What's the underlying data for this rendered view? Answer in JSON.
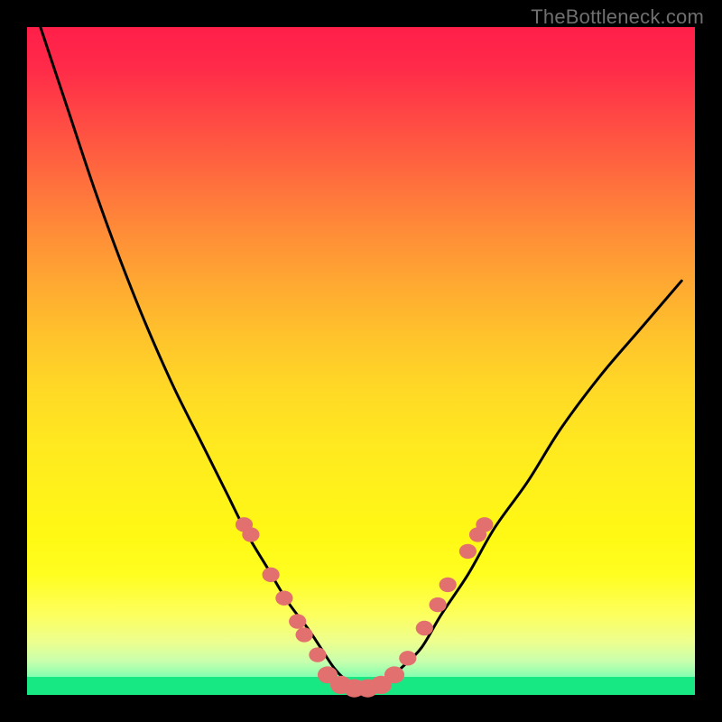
{
  "watermark": "TheBottleneck.com",
  "colors": {
    "frame": "#000000",
    "gradient_top": "#ff1f4a",
    "gradient_bottom": "#17e884",
    "curve_stroke": "#000000",
    "dot_fill": "#e2706e"
  },
  "chart_data": {
    "type": "line",
    "title": "",
    "xlabel": "",
    "ylabel": "",
    "xlim": [
      0,
      100
    ],
    "ylim": [
      0,
      100
    ],
    "series": [
      {
        "name": "bottleneck-curve",
        "x": [
          2,
          6,
          10,
          14,
          18,
          22,
          26,
          30,
          33,
          36,
          39,
          42,
          44,
          46,
          48,
          50,
          52,
          54,
          56,
          59,
          62,
          66,
          70,
          75,
          80,
          86,
          92,
          98
        ],
        "y": [
          100,
          88,
          76,
          65,
          55,
          46,
          38,
          30,
          24,
          19,
          14,
          10,
          7,
          4,
          2,
          1,
          1,
          2,
          4,
          7,
          12,
          18,
          25,
          32,
          40,
          48,
          55,
          62
        ]
      }
    ],
    "markers": {
      "name": "highlight-dots",
      "points": [
        {
          "x": 32.5,
          "y": 25.5,
          "r": 1.3
        },
        {
          "x": 33.5,
          "y": 24.0,
          "r": 1.3
        },
        {
          "x": 36.5,
          "y": 18.0,
          "r": 1.3
        },
        {
          "x": 38.5,
          "y": 14.5,
          "r": 1.3
        },
        {
          "x": 40.5,
          "y": 11.0,
          "r": 1.3
        },
        {
          "x": 41.5,
          "y": 9.0,
          "r": 1.3
        },
        {
          "x": 43.5,
          "y": 6.0,
          "r": 1.3
        },
        {
          "x": 45.0,
          "y": 3.0,
          "r": 1.5
        },
        {
          "x": 47.0,
          "y": 1.5,
          "r": 1.6
        },
        {
          "x": 49.0,
          "y": 1.0,
          "r": 1.6
        },
        {
          "x": 51.0,
          "y": 1.0,
          "r": 1.6
        },
        {
          "x": 53.0,
          "y": 1.5,
          "r": 1.6
        },
        {
          "x": 55.0,
          "y": 3.0,
          "r": 1.5
        },
        {
          "x": 57.0,
          "y": 5.5,
          "r": 1.3
        },
        {
          "x": 59.5,
          "y": 10.0,
          "r": 1.3
        },
        {
          "x": 61.5,
          "y": 13.5,
          "r": 1.3
        },
        {
          "x": 63.0,
          "y": 16.5,
          "r": 1.3
        },
        {
          "x": 66.0,
          "y": 21.5,
          "r": 1.3
        },
        {
          "x": 67.5,
          "y": 24.0,
          "r": 1.3
        },
        {
          "x": 68.5,
          "y": 25.5,
          "r": 1.3
        }
      ]
    }
  }
}
